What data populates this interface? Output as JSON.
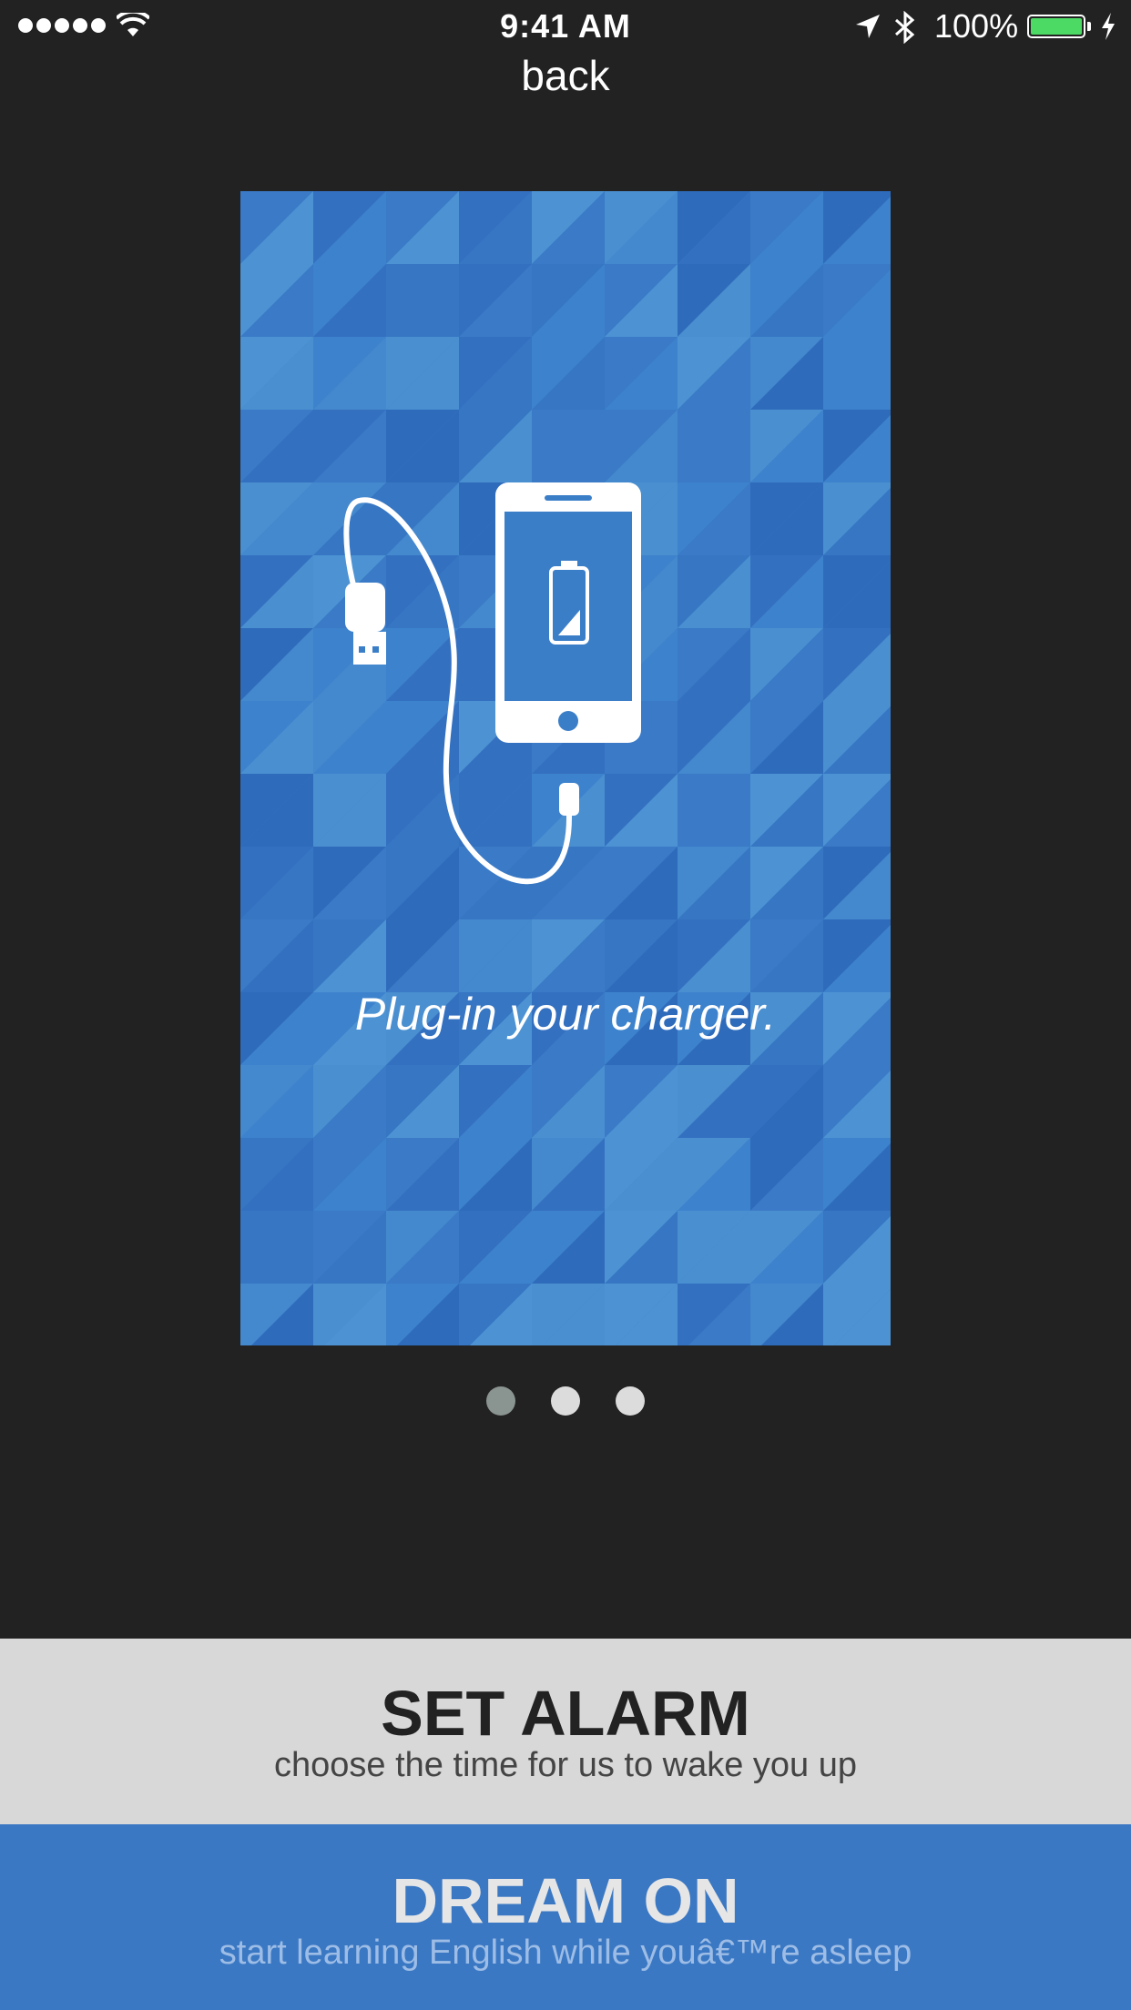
{
  "status_bar": {
    "time": "9:41 AM",
    "battery_percent": "100%",
    "battery_level": 1.0,
    "icons": [
      "signal-dots",
      "wifi-icon",
      "location-icon",
      "bluetooth-icon",
      "battery-icon",
      "charging-icon"
    ],
    "battery_color": "#4cd964"
  },
  "nav": {
    "back_label": "back"
  },
  "tutorial": {
    "caption": "Plug-in your charger.",
    "illustration": "phone-charger-illustration",
    "background_color": "#3b7ec8",
    "pages": 3,
    "current_page": 1,
    "dot_active_color": "#8a9490",
    "dot_inactive_color": "#dcdcdc"
  },
  "actions": {
    "set_alarm": {
      "title": "SET ALARM",
      "subtitle": "choose the time for us to wake you up",
      "background": "#d8d8d8"
    },
    "dream_on": {
      "title": "DREAM ON",
      "subtitle": "start learning English while youâ€™re asleep",
      "background": "#3b78c3"
    }
  }
}
